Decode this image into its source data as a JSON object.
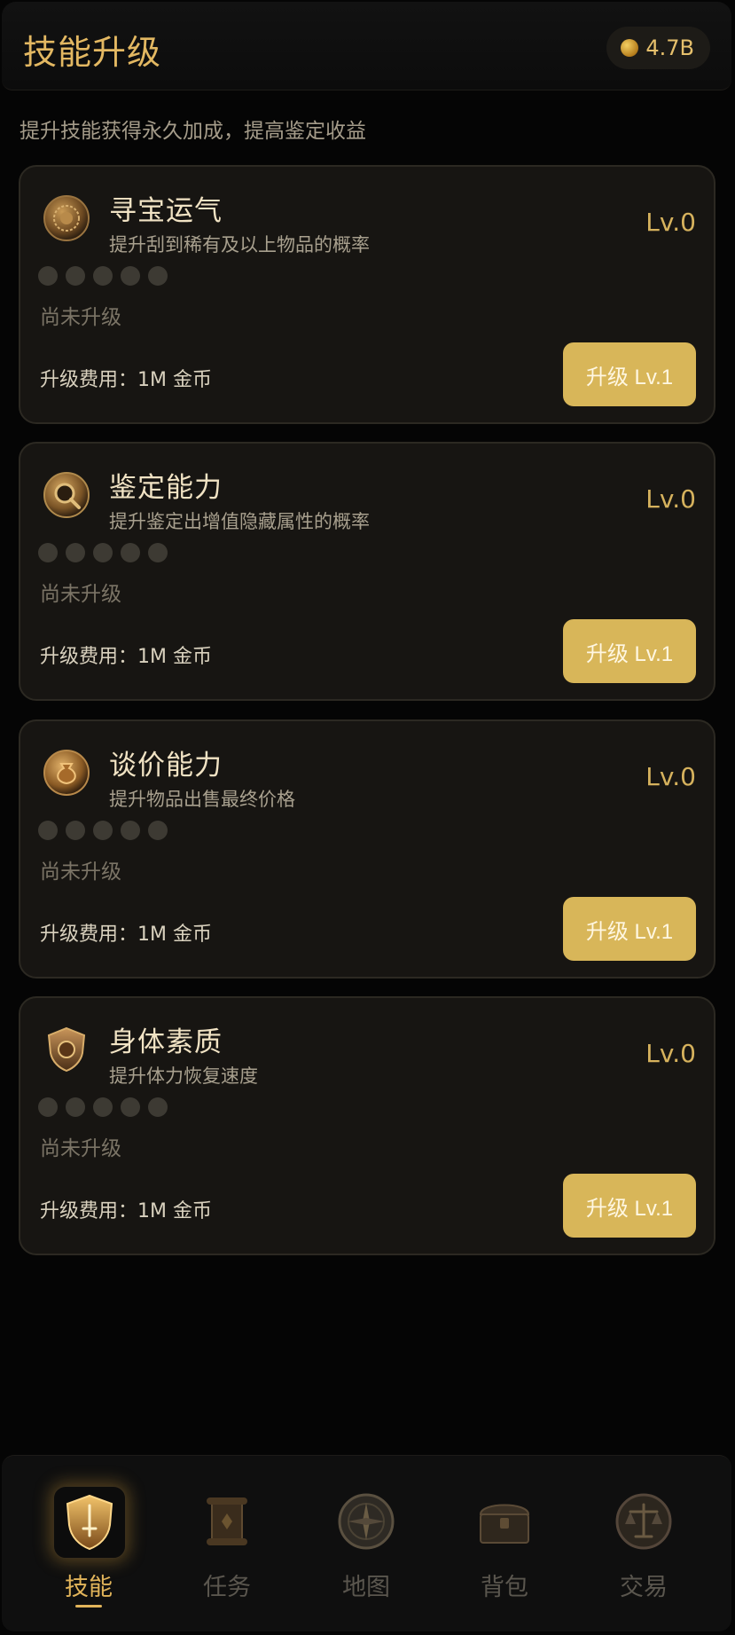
{
  "header": {
    "title": "技能升级",
    "coin_balance": "4.7B"
  },
  "subtitle": "提升技能获得永久加成，提高鉴定收益",
  "skills": [
    {
      "name": "寻宝运气",
      "description": "提升刮到稀有及以上物品的概率",
      "level": "Lv.0",
      "status": "尚未升级",
      "cost": "升级费用：1M 金币",
      "button": "升级 Lv.1",
      "icon": "lion-medallion-icon"
    },
    {
      "name": "鉴定能力",
      "description": "提升鉴定出增值隐藏属性的概率",
      "level": "Lv.0",
      "status": "尚未升级",
      "cost": "升级费用：1M 金币",
      "button": "升级 Lv.1",
      "icon": "magnifier-medallion-icon"
    },
    {
      "name": "谈价能力",
      "description": "提升物品出售最终价格",
      "level": "Lv.0",
      "status": "尚未升级",
      "cost": "升级费用：1M 金币",
      "button": "升级 Lv.1",
      "icon": "moneybag-medallion-icon"
    },
    {
      "name": "身体素质",
      "description": "提升体力恢复速度",
      "level": "Lv.0",
      "status": "尚未升级",
      "cost": "升级费用：1M 金币",
      "button": "升级 Lv.1",
      "icon": "shield-crest-icon"
    }
  ],
  "nav": [
    {
      "label": "技能",
      "icon": "shield-sword-icon",
      "active": true
    },
    {
      "label": "任务",
      "icon": "scroll-icon",
      "active": false
    },
    {
      "label": "地图",
      "icon": "compass-icon",
      "active": false
    },
    {
      "label": "背包",
      "icon": "chest-icon",
      "active": false
    },
    {
      "label": "交易",
      "icon": "scales-icon",
      "active": false
    }
  ],
  "colors": {
    "accent_gold": "#e3b862",
    "button_gold": "#d8b659",
    "card_bg": "#171512",
    "page_bg": "#050505"
  }
}
